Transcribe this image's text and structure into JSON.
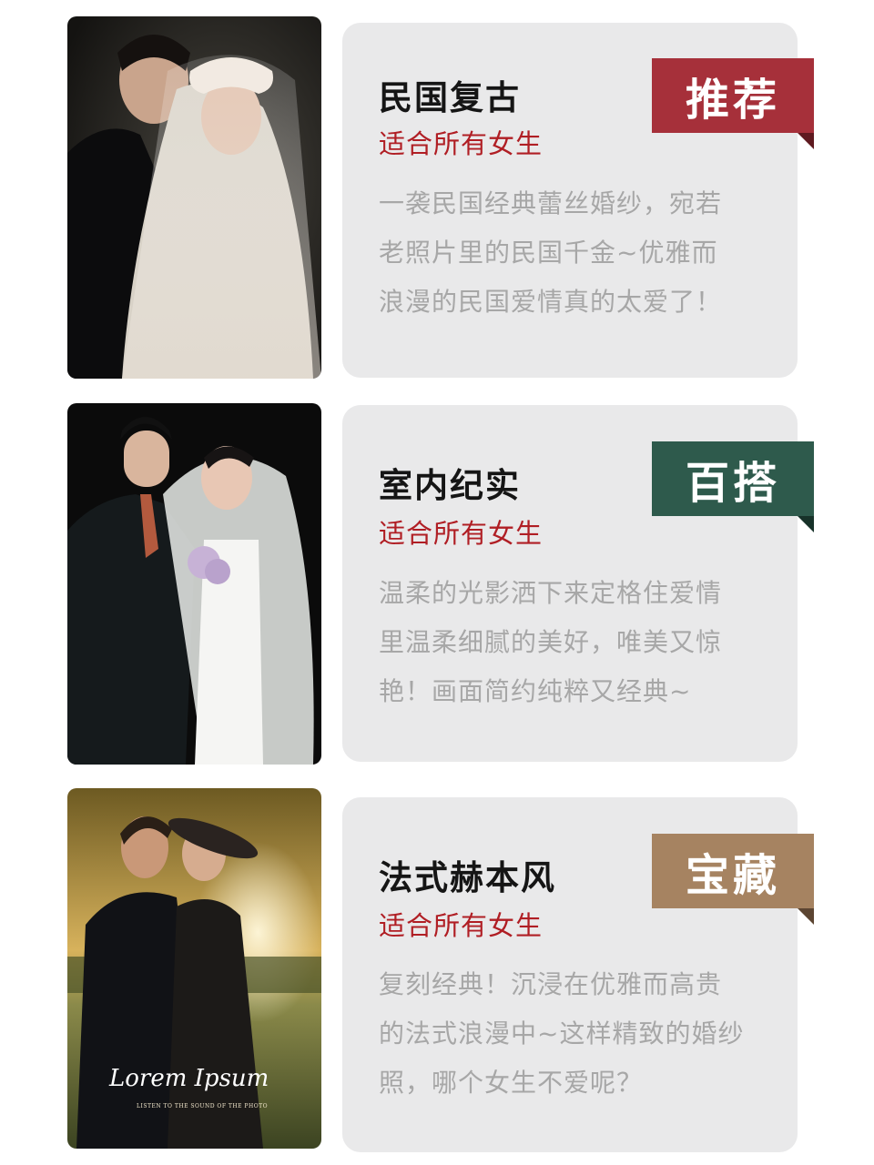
{
  "items": [
    {
      "title": "民国复古",
      "subtitle": "适合所有女生",
      "badge": "推荐",
      "badge_color": "#a6303a",
      "badge_fold_color": "#5f1a20",
      "lines": [
        "一袭民国经典蕾丝婚纱，宛若",
        "老照片里的民国千金~优雅而",
        "浪漫的民国爱情真的太爱了！"
      ]
    },
    {
      "title": "室内纪实",
      "subtitle": "适合所有女生",
      "badge": "百搭",
      "badge_color": "#2e5a4c",
      "badge_fold_color": "#173229",
      "lines": [
        "温柔的光影洒下来定格住爱情",
        "里温柔细腻的美好，唯美又惊",
        "艳！画面简约纯粹又经典~"
      ]
    },
    {
      "title": "法式赫本风",
      "subtitle": "适合所有女生",
      "badge": "宝藏",
      "badge_color": "#a68361",
      "badge_fold_color": "#5c4532",
      "lines": [
        "复刻经典！沉浸在优雅而高贵",
        "的法式浪漫中~这样精致的婚纱",
        "照，哪个女生不爱呢？"
      ]
    }
  ],
  "photo3_watermark": "Lorem Ipsum",
  "photo3_watermark_small": "LISTEN TO THE SOUND OF THE PHOTO"
}
